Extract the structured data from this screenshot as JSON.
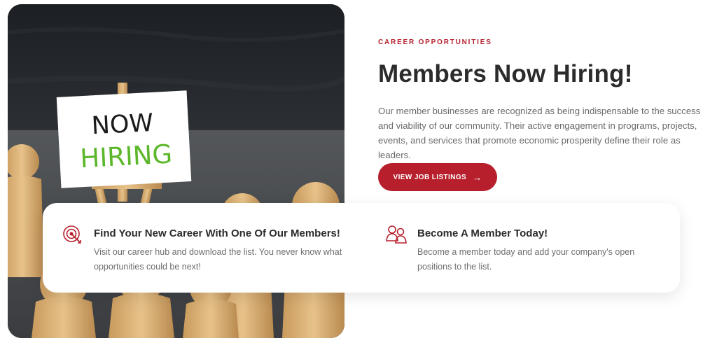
{
  "hero": {
    "sign_line1": "NOW",
    "sign_line2": "HIRING"
  },
  "header": {
    "kicker": "CAREER OPPORTUNITIES",
    "title": "Members Now Hiring!",
    "intro": "Our member businesses are recognized as being indispensable to the success and viability of our community. Their active engagement in programs, projects, events, and services that promote economic prosperity define their role as leaders."
  },
  "cta": {
    "label": "VIEW JOB LISTINGS",
    "icon": "arrow-right-icon"
  },
  "features": [
    {
      "icon": "target-icon",
      "title": "Find Your New Career With One Of Our Members!",
      "description": "Visit our career hub and download the list. You never know what opportunities could be next!"
    },
    {
      "icon": "members-icon",
      "title": "Become A Member Today!",
      "description": "Become a member today and add your company's open positions to the list."
    }
  ],
  "colors": {
    "accent": "#b71f2c",
    "heading": "#2b2b2b",
    "body_text": "#6a6a6a",
    "sign_green": "#5cb82a"
  }
}
